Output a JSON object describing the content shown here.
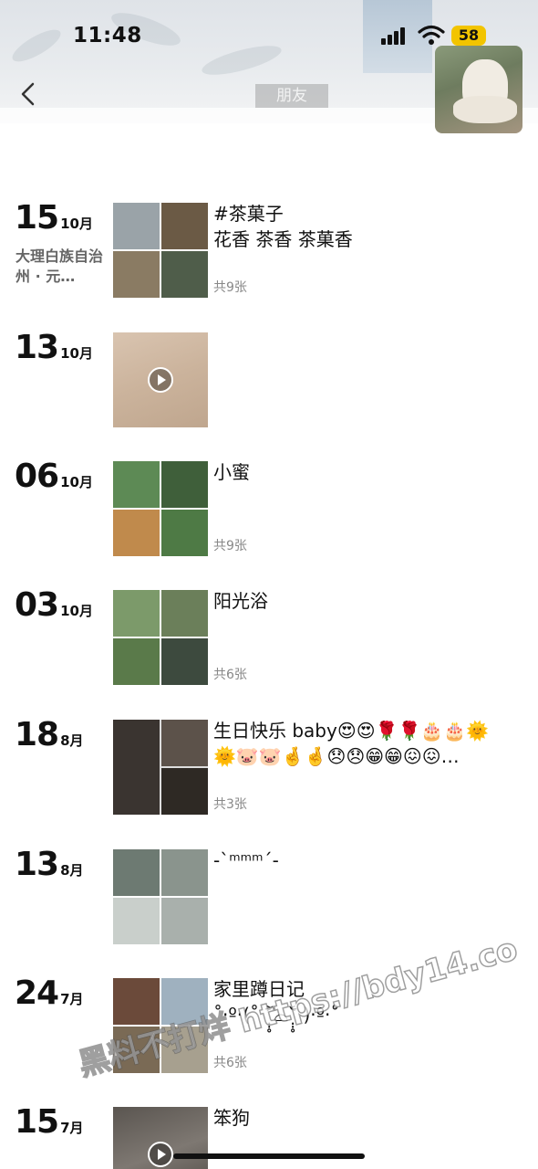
{
  "status": {
    "time": "11:48",
    "battery": "58"
  },
  "header": {
    "title": "朋友"
  },
  "entries": [
    {
      "day": "15",
      "month": "10月",
      "location": "大理白族自治州 · 元…",
      "caption": "#茶菓子\n花香 茶香 茶菓香",
      "count": "共9张",
      "type": "grid4"
    },
    {
      "day": "13",
      "month": "10月",
      "location": "",
      "caption": "",
      "count": "",
      "type": "video"
    },
    {
      "day": "06",
      "month": "10月",
      "location": "",
      "caption": "小蜜",
      "count": "共9张",
      "type": "grid4"
    },
    {
      "day": "03",
      "month": "10月",
      "location": "",
      "caption": "阳光浴",
      "count": "共6张",
      "type": "grid4"
    },
    {
      "day": "18",
      "month": "8月",
      "location": "",
      "caption": "生日快乐 baby😍😍🌹🌹🎂🎂🌞\n🌞🐷🐷🤞🤞😞😞😁😁😖😖…",
      "count": "共3张",
      "type": "grid3"
    },
    {
      "day": "13",
      "month": "8月",
      "location": "",
      "caption": "-`ᵐᵐᵐ´-",
      "count": "",
      "type": "grid4"
    },
    {
      "day": "24",
      "month": "7月",
      "location": "",
      "caption": "家里蹲日记\n˚‧º·(˚ ˃̣̣̥᷄⌓˂̣̣̥᷅ )‧º·˚",
      "count": "共6张",
      "type": "grid4"
    },
    {
      "day": "15",
      "month": "7月",
      "location": "",
      "caption": "笨狗",
      "count": "",
      "type": "video"
    }
  ],
  "watermark": "黑料不打烊 https://bdy14.co"
}
